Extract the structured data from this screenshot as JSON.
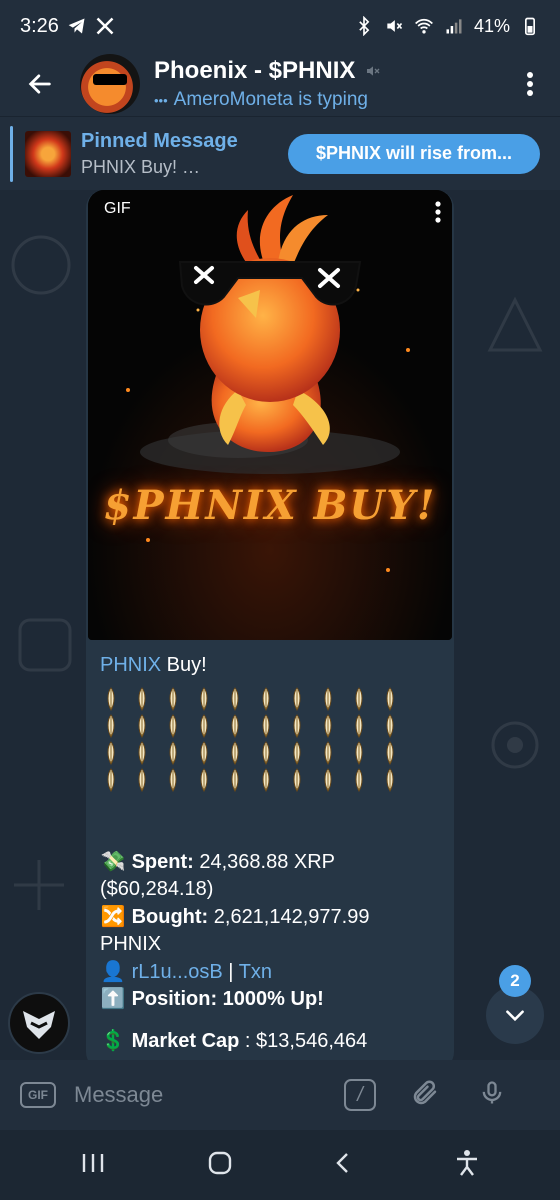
{
  "status_bar": {
    "time": "3:26",
    "battery": "41%"
  },
  "header": {
    "title": "Phoenix - $PHNIX",
    "typing_dots": "•••",
    "subtitle": "AmeroMoneta is typing"
  },
  "pinned": {
    "title": "Pinned Message",
    "preview": "PHNIX Buy!  …",
    "button_label": "$PHNIX will rise from..."
  },
  "message": {
    "gif_label": "GIF",
    "gif_caption": "$PHNIX BUY!",
    "title_link": "PHNIX",
    "title_rest": " Buy!",
    "feather_rows": 4,
    "feather_cols": 10,
    "spent_emoji": "💸",
    "spent_label": "Spent:",
    "spent_value": " 24,368.88 XRP",
    "spent_usd": "($60,284.18)",
    "bought_emoji": "🔀",
    "bought_label": "Bought:",
    "bought_value": " 2,621,142,977.99",
    "bought_token": "PHNIX",
    "wallet_emoji": "👤",
    "wallet_link": "rL1u...osB",
    "separator": " | ",
    "txn_link": "Txn",
    "position_emoji": "⬆️",
    "position_text": "Position: 1000% Up!",
    "mcap_emoji": "💲",
    "mcap_label": " Market Cap",
    "mcap_value": " : $13,546,464"
  },
  "scroll": {
    "unread_count": "2"
  },
  "input": {
    "gif_button": "GIF",
    "placeholder": "Message",
    "command_button": "/"
  },
  "colors": {
    "accent": "#4a9fe6",
    "link": "#6fb0e8",
    "background": "#1e2936",
    "bubble": "#263645"
  }
}
